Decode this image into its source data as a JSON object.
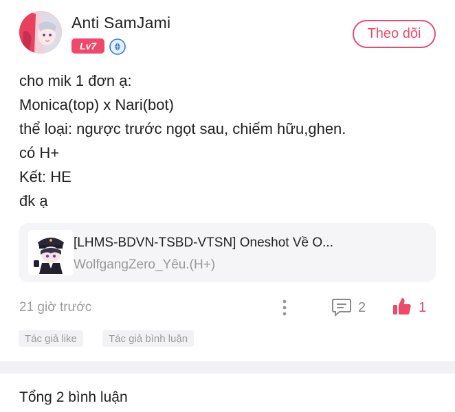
{
  "author": {
    "name": "Anti SamJami",
    "level": "Lv7",
    "avatar_icon": "anime-avatar",
    "verify_icon": "blue-diamond-badge-icon"
  },
  "follow_button": {
    "label": "Theo dõi"
  },
  "content": {
    "lines": [
      "cho mik 1 đơn ạ:",
      "Monica(top) x Nari(bot)",
      "thể loại: ngược trước ngọt sau, chiếm hữu,ghen.",
      "có H+",
      "Kết: HE",
      "đk ạ"
    ]
  },
  "linked_story": {
    "title": "[LHMS-BDVN-TSBD-VTSN] Oneshot Về O...",
    "author": "WolfgangZero_Yêu.(H+)",
    "thumbnail_icon": "chibi-character-thumbnail"
  },
  "meta": {
    "timestamp": "21 giờ trước",
    "comment_count": "2",
    "like_count": "1"
  },
  "tags": {
    "author_liked": "Tác giả like",
    "author_commented": "Tác giả bình luận"
  },
  "comments": {
    "header": "Tổng 2 bình luận"
  },
  "colors": {
    "accent": "#f0486a",
    "muted": "#9a9a9a",
    "card_bg": "#f5f5f7",
    "verify_blue": "#2f7be0"
  }
}
